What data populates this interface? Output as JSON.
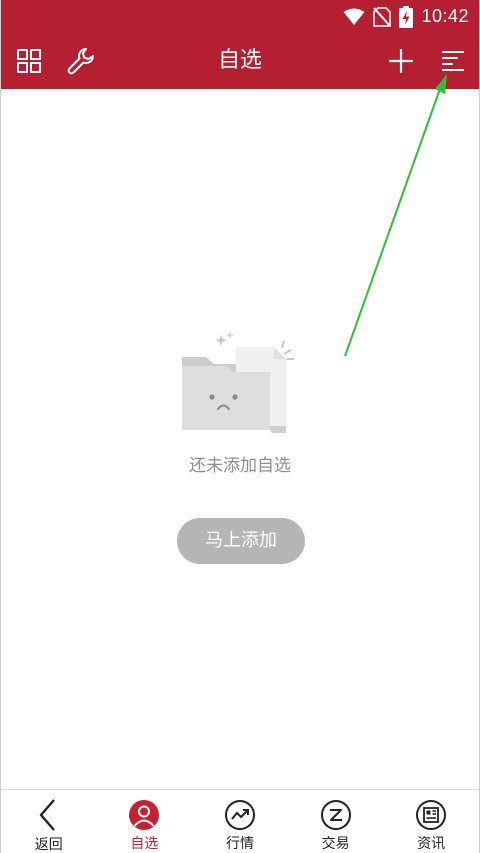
{
  "status_bar": {
    "time": "10:42"
  },
  "header": {
    "title": "自选"
  },
  "empty_state": {
    "message": "还未添加自选",
    "action_label": "马上添加"
  },
  "tabs": [
    {
      "label": "返回",
      "icon": "back-arrow-icon"
    },
    {
      "label": "自选",
      "icon": "person-icon"
    },
    {
      "label": "行情",
      "icon": "trend-chart-icon"
    },
    {
      "label": "交易",
      "icon": "trade-icon"
    },
    {
      "label": "资讯",
      "icon": "news-icon"
    }
  ],
  "colors": {
    "brand": "#b51f32",
    "active_tab": "#c8202f",
    "button_gray": "#b5b5b5",
    "annotation_arrow": "#2bc234"
  }
}
